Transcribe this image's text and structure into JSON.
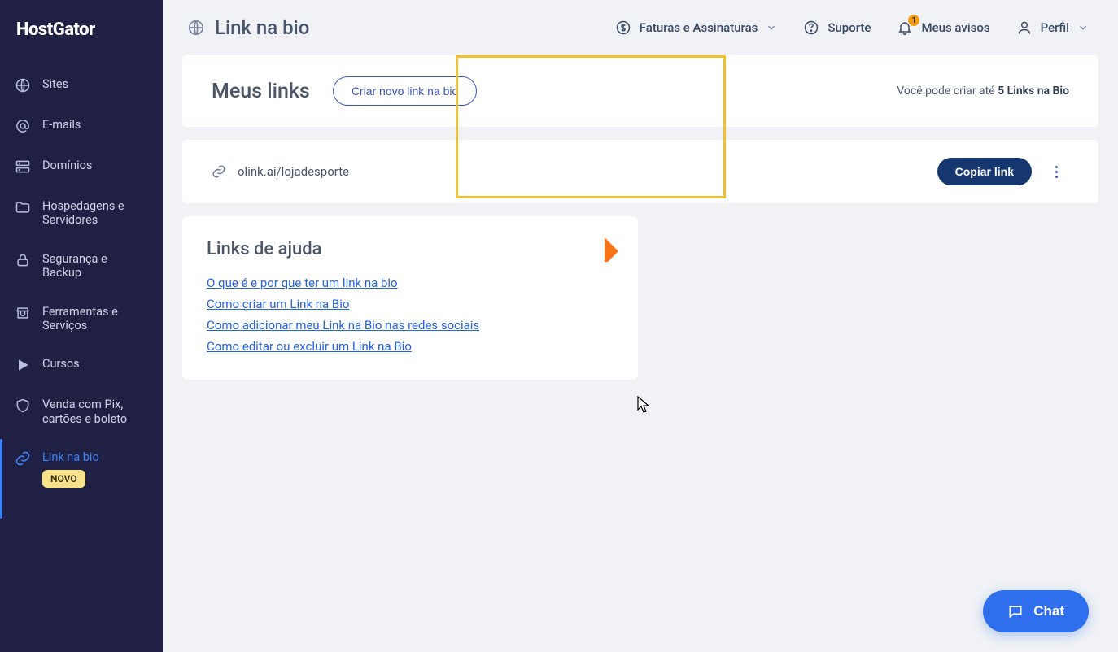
{
  "brand": "HostGator",
  "sidebar": {
    "items": [
      {
        "label": "Sites"
      },
      {
        "label": "E-mails"
      },
      {
        "label": "Domínios"
      },
      {
        "label": "Hospedagens e Servidores"
      },
      {
        "label": "Segurança e Backup"
      },
      {
        "label": "Ferramentas e Serviços"
      },
      {
        "label": "Cursos"
      },
      {
        "label": "Venda com Pix, cartões e boleto"
      },
      {
        "label": "Link na bio",
        "badge": "NOVO"
      }
    ]
  },
  "header": {
    "page_title": "Link na bio",
    "menu": {
      "billing": "Faturas e Assinaturas",
      "support": "Suporte",
      "notifications": "Meus avisos",
      "notifications_count": "1",
      "profile": "Perfil"
    }
  },
  "my_links": {
    "title": "Meus links",
    "create_label": "Criar novo link na bio",
    "quota_prefix": "Você pode criar até ",
    "quota_bold": "5 Links na Bio"
  },
  "link_row": {
    "url": "olink.ai/lojadesporte",
    "copy_label": "Copiar link"
  },
  "help": {
    "title": "Links de ajuda",
    "links": [
      "O que é e por que ter um link na bio",
      "Como criar um Link na Bio",
      "Como adicionar meu Link na Bio nas redes sociais",
      "Como editar ou excluir um Link na Bio"
    ]
  },
  "chat_label": "Chat"
}
